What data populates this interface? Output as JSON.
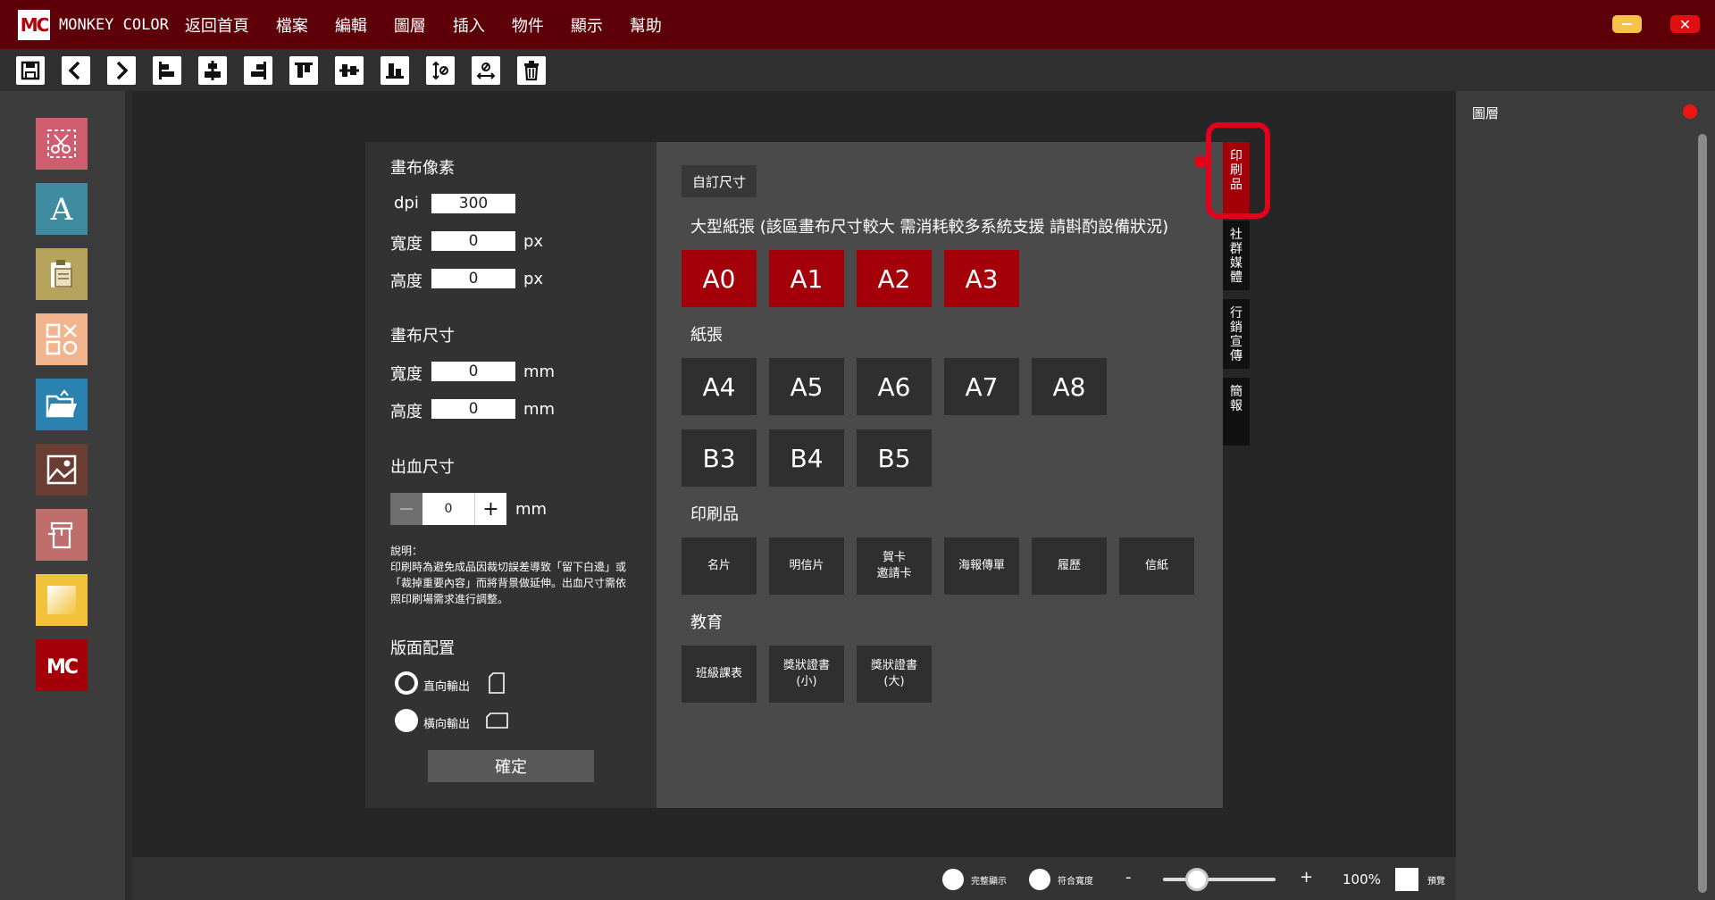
{
  "app": {
    "logo": "MC",
    "brand": "MONKEY COLOR",
    "menu": [
      "返回首頁",
      "檔案",
      "編輯",
      "圖層",
      "插入",
      "物件",
      "顯示",
      "幫助"
    ],
    "close_glyph": "✕"
  },
  "toolbar": {
    "icons": [
      "save-icon",
      "undo-icon",
      "redo-icon",
      "align-left-icon",
      "align-center-icon",
      "align-right-icon",
      "align-top-icon",
      "align-middle-icon",
      "align-bottom-icon",
      "flip-vertical-icon",
      "flip-horizontal-icon",
      "delete-icon"
    ]
  },
  "tools": [
    "crop-icon",
    "text-icon",
    "paste-icon",
    "shapes-icon",
    "open-folder-icon",
    "image-icon",
    "sticker-icon",
    "gradient-icon",
    "mc-logo-icon"
  ],
  "tool_colors": [
    "#cf5d6f",
    "#3f8ba0",
    "#b6a35c",
    "#f2b48c",
    "#2b82b0",
    "#6a3d32",
    "#c06e6b",
    "#f2c23a",
    "#a4000a"
  ],
  "canvas_settings": {
    "pixels_title": "畫布像素",
    "dpi_label": "dpi",
    "dpi_value": "300",
    "px_width_label": "寬度",
    "px_width_value": "0",
    "px_height_label": "高度",
    "px_height_value": "0",
    "px_unit": "px",
    "size_title": "畫布尺寸",
    "mm_width_label": "寬度",
    "mm_width_value": "0",
    "mm_height_label": "高度",
    "mm_height_value": "0",
    "mm_unit": "mm",
    "bleed_title": "出血尺寸",
    "bleed_minus": "−",
    "bleed_value": "0",
    "bleed_plus": "+",
    "bleed_unit": "mm",
    "note_title": "說明：",
    "note_body": "印刷時為避免成品因裁切誤差導致「留下白邊」或「裁掉重要內容」而將背景做延伸。出血尺寸需依照印刷場需求進行調整。",
    "layout_title": "版面配置",
    "portrait_label": "直向輸出",
    "landscape_label": "橫向輸出",
    "confirm_label": "確定"
  },
  "presets": {
    "custom_size_label": "自訂尺寸",
    "large_title": "大型紙張 (該區畫布尺寸較大 需消耗較多系統支援 請斟酌設備狀況)",
    "large": [
      "A0",
      "A1",
      "A2",
      "A3"
    ],
    "paper_title": "紙張",
    "paper_row1": [
      "A4",
      "A5",
      "A6",
      "A7",
      "A8"
    ],
    "paper_row2": [
      "B3",
      "B4",
      "B5"
    ],
    "print_title": "印刷品",
    "print_items": [
      "名片",
      "明信片",
      "賀卡\n邀請卡",
      "海報傳單",
      "履歷",
      "信紙"
    ],
    "edu_title": "教育",
    "edu_items": [
      "班級課表",
      "獎狀證書\n(小)",
      "獎狀證書\n(大)"
    ]
  },
  "category_tabs": [
    {
      "label": [
        "印",
        "刷",
        "品"
      ],
      "active": true
    },
    {
      "label": [
        "社",
        "群",
        "媒",
        "體"
      ],
      "active": false
    },
    {
      "label": [
        "行",
        "銷",
        "宣",
        "傳"
      ],
      "active": false
    },
    {
      "label": [
        "簡",
        "報"
      ],
      "active": false
    }
  ],
  "layer_panel": {
    "title": "圖層"
  },
  "statusbar": {
    "fit_all_label": "完整顯示",
    "fit_width_label": "符合寬度",
    "zoom_minus": "-",
    "zoom_plus": "+",
    "zoom_value": "100%",
    "zoom_level": 0.3,
    "preview_label": "預覽"
  },
  "colors": {
    "titlebar": "#5e0008",
    "accent": "#a4000a",
    "highlight": "#e3001b"
  }
}
